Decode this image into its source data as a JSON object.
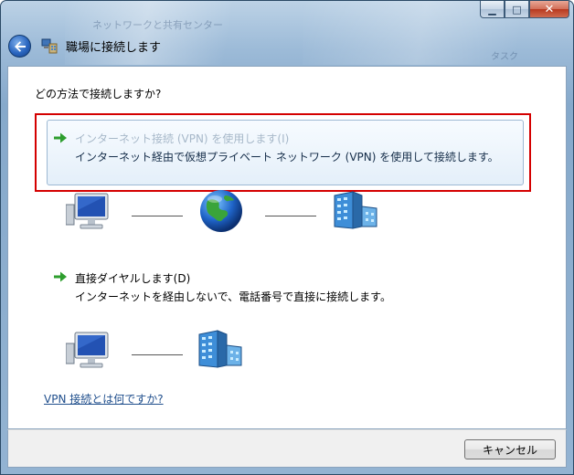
{
  "window": {
    "title": "職場に接続します",
    "background_ghost_text": "ネットワークと共有センター",
    "background_ghost_text2": "タスク"
  },
  "caption_buttons": {
    "minimize_symbol": "▁",
    "maximize_symbol": "□",
    "close_symbol": "✕"
  },
  "content": {
    "question": "どの方法で接続しますか?",
    "options": [
      {
        "title": "インターネット接続 (VPN) を使用します(I)",
        "description": "インターネット経由で仮想プライベート ネットワーク (VPN) を使用して接続します。",
        "state": "hover"
      },
      {
        "title": "直接ダイヤルします(D)",
        "description": "インターネットを経由しないで、電話番号で直接に接続します。",
        "state": "normal"
      }
    ],
    "help_link": "VPN 接続とは何ですか?"
  },
  "footer": {
    "cancel_label": "キャンセル"
  },
  "icons": {
    "back": "back-arrow-icon",
    "wizard": "network-wizard-icon",
    "option_arrow": "green-arrow-icon",
    "computer": "computer-icon",
    "globe": "globe-icon",
    "office": "office-building-icon"
  },
  "colors": {
    "highlight_border": "#d40000",
    "link": "#1f4e8c",
    "hover_title": "#a7b8c9",
    "hover_desc": "#152d49",
    "arrow_green": "#2e9e2e"
  }
}
